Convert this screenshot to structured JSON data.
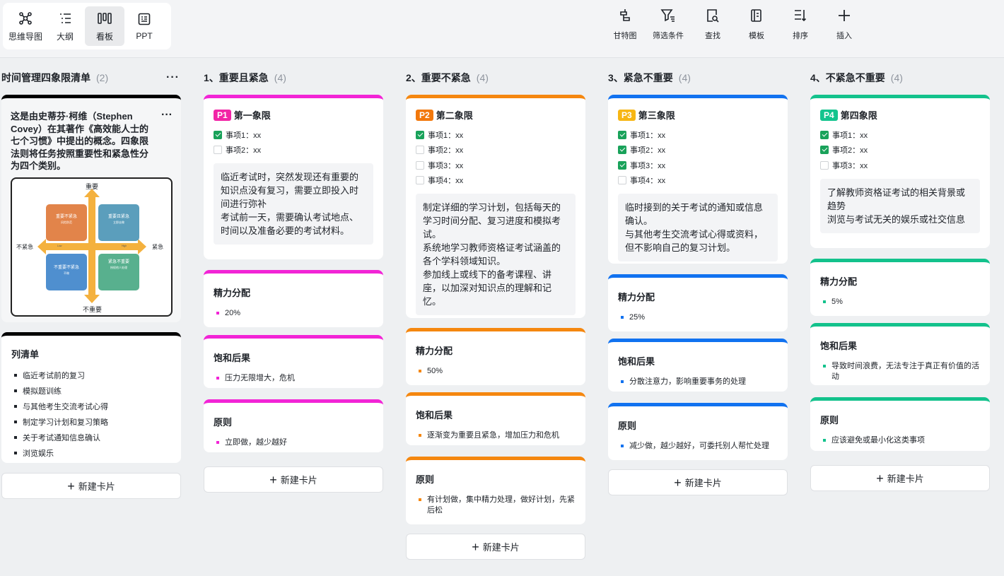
{
  "views": [
    {
      "label": "思维导图",
      "icon": "mindmap-icon"
    },
    {
      "label": "大纲",
      "icon": "outline-icon"
    },
    {
      "label": "看板",
      "icon": "kanban-icon"
    },
    {
      "label": "PPT",
      "icon": "ppt-icon"
    }
  ],
  "active_view": "看板",
  "tools": [
    {
      "label": "甘特图",
      "icon": "gantt-icon"
    },
    {
      "label": "筛选条件",
      "icon": "filter-icon"
    },
    {
      "label": "查找",
      "icon": "find-icon"
    },
    {
      "label": "模板",
      "icon": "template-icon"
    },
    {
      "label": "排序",
      "icon": "sort-icon"
    },
    {
      "label": "插入",
      "icon": "plus-icon"
    }
  ],
  "new_card_label": "新建卡片",
  "intro": {
    "title": "时间管理四象限清单",
    "count": "(2)",
    "text": "这是由史蒂芬·柯维（Stephen Covey）在其著作《高效能人士的七个习惯》中提出的概念。四象限法则将任务按照重要性和紧急性分为四个类别。",
    "diagram": {
      "top": "重要",
      "bottom": "不重要",
      "left": "不紧急",
      "right": "紧急",
      "low": "Low",
      "high": "High",
      "q1": "重要不紧急",
      "q1sub": "风险防范",
      "q2": "重要且紧急",
      "q2sub": "立即去做",
      "q3": "不重要不紧急",
      "q3sub": "不做",
      "q4": "紧急不重要",
      "q4sub": "授权他人处理"
    },
    "list_title": "列清单",
    "list": [
      "临近考试前的复习",
      "模拟题训练",
      "与其他考生交流考试心得",
      "制定学习计划和复习策略",
      "关于考试通知信息确认",
      "浏览娱乐"
    ]
  },
  "columns": [
    {
      "title": "1、重要且紧急",
      "count": "(4)",
      "color": "#f224d6",
      "tag": "P1",
      "tag_color": "#f224a6",
      "quadrant": "第一象限",
      "items": [
        {
          "text": "事项1：xx",
          "checked": true
        },
        {
          "text": "事项2：xx",
          "checked": false
        }
      ],
      "note": "临近考试时，突然发现还有重要的知识点没有复习，需要立即投入时间进行弥补\n考试前一天，需要确认考试地点、时间以及准备必要的考试材料。",
      "energy_title": "精力分配",
      "energy": "20%",
      "consequence_title": "饱和后果",
      "consequence": "压力无限增大，危机",
      "principle_title": "原则",
      "principle": "立即做，越少越好"
    },
    {
      "title": "2、重要不紧急",
      "count": "(4)",
      "color": "#f5870f",
      "tag": "P2",
      "tag_color": "#f2780c",
      "quadrant": "第二象限",
      "items": [
        {
          "text": "事项1：xx",
          "checked": true
        },
        {
          "text": "事项2：xx",
          "checked": false
        },
        {
          "text": "事项3：xx",
          "checked": false
        },
        {
          "text": "事项4：xx",
          "checked": false
        }
      ],
      "note": "制定详细的学习计划，包括每天的学习时间分配、复习进度和模拟考试。\n系统地学习教师资格证考试涵盖的各个学科领域知识。\n参加线上或线下的备考课程、讲座，以加深对知识点的理解和记忆。",
      "energy_title": "精力分配",
      "energy": "50%",
      "consequence_title": "饱和后果",
      "consequence": "逐渐变为重要且紧急，增加压力和危机",
      "principle_title": "原则",
      "principle": "有计划做，集中精力处理，做好计划，先紧后松"
    },
    {
      "title": "3、紧急不重要",
      "count": "(4)",
      "color": "#1172f0",
      "tag": "P3",
      "tag_color": "#f7b614",
      "quadrant": "第三象限",
      "items": [
        {
          "text": "事项1：xx",
          "checked": true
        },
        {
          "text": "事项2：xx",
          "checked": true
        },
        {
          "text": "事项3：xx",
          "checked": true
        },
        {
          "text": "事项4：xx",
          "checked": false
        }
      ],
      "note": "临时接到的关于考试的通知或信息确认。\n与其他考生交流考试心得或资料，但不影响自己的复习计划。",
      "energy_title": "精力分配",
      "energy": "25%",
      "consequence_title": "饱和后果",
      "consequence": "分散注意力，影响重要事务的处理",
      "principle_title": "原则",
      "principle": "减少做，越少越好，可委托别人帮忙处理"
    },
    {
      "title": "4、不紧急不重要",
      "count": "(4)",
      "color": "#13c28c",
      "tag": "P4",
      "tag_color": "#14c48e",
      "quadrant": "第四象限",
      "items": [
        {
          "text": "事项1：xx",
          "checked": true
        },
        {
          "text": "事项2：xx",
          "checked": true
        },
        {
          "text": "事项3：xx",
          "checked": false
        }
      ],
      "note": "了解教师资格证考试的相关背景或趋势\n浏览与考试无关的娱乐或社交信息",
      "energy_title": "精力分配",
      "energy": "5%",
      "consequence_title": "饱和后果",
      "consequence": "导致时间浪费，无法专注于真正有价值的活动",
      "principle_title": "原则",
      "principle": "应该避免或最小化这类事项"
    }
  ]
}
